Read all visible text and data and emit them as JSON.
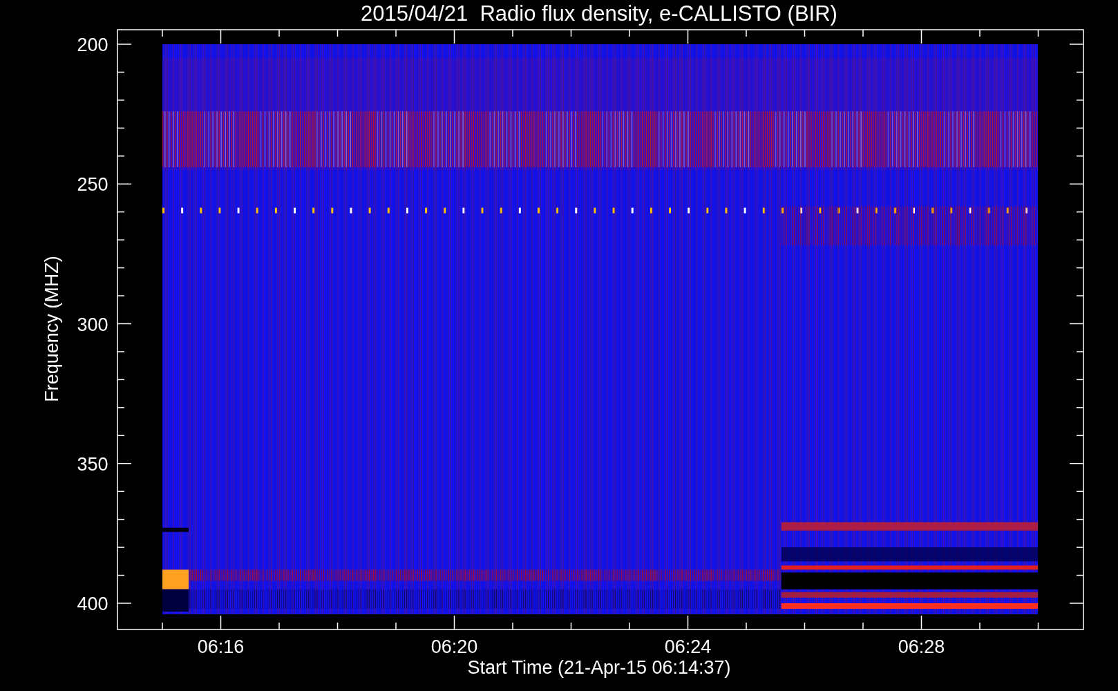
{
  "title": "2015/04/21  Radio flux density, e-CALLISTO (BIR)",
  "y_axis": {
    "label": "Frequency (MHZ)",
    "ticks": [
      "200",
      "250",
      "300",
      "350",
      "400"
    ]
  },
  "x_axis": {
    "label": "Start Time (21-Apr-15 06:14:37)",
    "ticks": [
      "06:16",
      "06:20",
      "06:24",
      "06:28"
    ]
  }
}
